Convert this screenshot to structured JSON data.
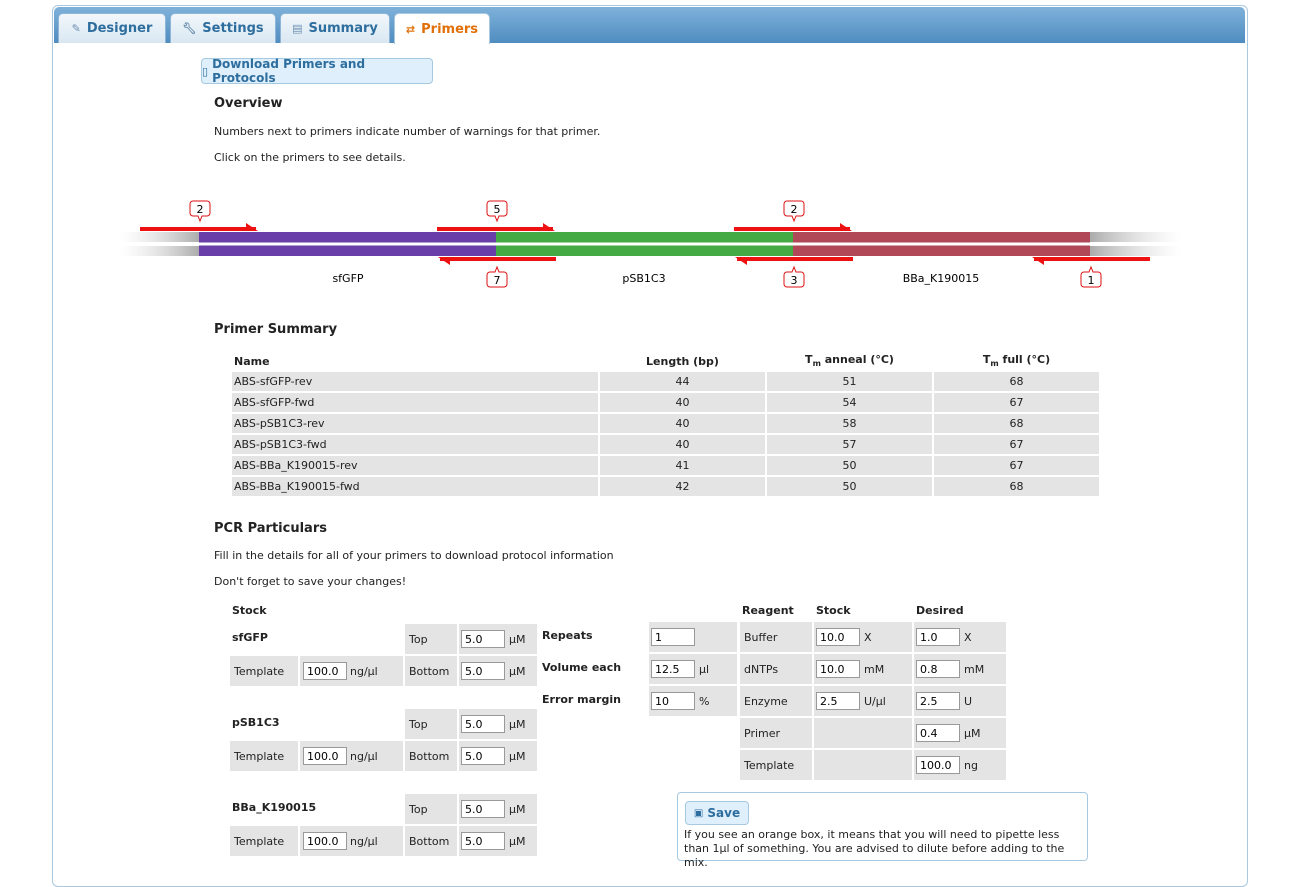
{
  "tabs": [
    {
      "label": "Designer",
      "icon": "pencil-icon"
    },
    {
      "label": "Settings",
      "icon": "wrench-icon"
    },
    {
      "label": "Summary",
      "icon": "document-icon"
    },
    {
      "label": "Primers",
      "icon": "swap-arrows-icon",
      "active": true
    }
  ],
  "download_button": "Download Primers and Protocols",
  "overview": {
    "heading": "Overview",
    "line1": "Numbers next to primers indicate number of warnings for that primer.",
    "line2": "Click on the primers to see details."
  },
  "diagram": {
    "parts": [
      {
        "name": "sfGFP",
        "color": "#6a3ea8"
      },
      {
        "name": "pSB1C3",
        "color": "#44aa44"
      },
      {
        "name": "BBa_K190015",
        "color": "#b04858"
      }
    ],
    "warnings_top": [
      "2",
      "5",
      "2"
    ],
    "warnings_bottom": [
      "7",
      "3",
      "1"
    ],
    "primer_color": "#ee1111"
  },
  "primer_summary": {
    "heading": "Primer Summary",
    "col_name": "Name",
    "col_length": "Length (bp)",
    "col_tm_anneal": "anneal (°C)",
    "col_tm_full": "full (°C)",
    "tm_T": "T",
    "tm_sub": "m",
    "rows": [
      {
        "name": "ABS-sfGFP-rev",
        "length": "44",
        "anneal": "51",
        "full": "68"
      },
      {
        "name": "ABS-sfGFP-fwd",
        "length": "40",
        "anneal": "54",
        "full": "67"
      },
      {
        "name": "ABS-pSB1C3-rev",
        "length": "40",
        "anneal": "58",
        "full": "68"
      },
      {
        "name": "ABS-pSB1C3-fwd",
        "length": "40",
        "anneal": "57",
        "full": "67"
      },
      {
        "name": "ABS-BBa_K190015-rev",
        "length": "41",
        "anneal": "50",
        "full": "67"
      },
      {
        "name": "ABS-BBa_K190015-fwd",
        "length": "42",
        "anneal": "50",
        "full": "68"
      }
    ]
  },
  "pcr": {
    "heading": "PCR Particulars",
    "line1": "Fill in the details for all of your primers to download protocol information",
    "line2": "Don't forget to save your changes!",
    "stock_heading": "Stock",
    "stocks": [
      {
        "part": "sfGFP",
        "top_label": "Top",
        "top": "5.0",
        "bottom_label": "Bottom",
        "bottom": "5.0",
        "conc_unit": "μM",
        "template_label": "Template",
        "template": "100.0",
        "template_unit": "ng/μl"
      },
      {
        "part": "pSB1C3",
        "top_label": "Top",
        "top": "5.0",
        "bottom_label": "Bottom",
        "bottom": "5.0",
        "conc_unit": "μM",
        "template_label": "Template",
        "template": "100.0",
        "template_unit": "ng/μl"
      },
      {
        "part": "BBa_K190015",
        "top_label": "Top",
        "top": "5.0",
        "bottom_label": "Bottom",
        "bottom": "5.0",
        "conc_unit": "μM",
        "template_label": "Template",
        "template": "100.0",
        "template_unit": "ng/μl"
      }
    ],
    "params": [
      {
        "label": "Repeats",
        "value": "1",
        "unit": ""
      },
      {
        "label": "Volume each",
        "value": "12.5",
        "unit": "μl"
      },
      {
        "label": "Error margin",
        "value": "10",
        "unit": "%"
      }
    ],
    "reagent_heading": "Reagent",
    "reagent_stock_heading": "Stock",
    "reagent_desired_heading": "Desired",
    "reagents": [
      {
        "name": "Buffer",
        "stock": "10.0",
        "stock_unit": "X",
        "desired": "1.0",
        "desired_unit": "X"
      },
      {
        "name": "dNTPs",
        "stock": "10.0",
        "stock_unit": "mM",
        "desired": "0.8",
        "desired_unit": "mM"
      },
      {
        "name": "Enzyme",
        "stock": "2.5",
        "stock_unit": "U/μl",
        "desired": "2.5",
        "desired_unit": "U"
      },
      {
        "name": "Primer",
        "stock": "",
        "stock_unit": "",
        "desired": "0.4",
        "desired_unit": "μM"
      },
      {
        "name": "Template",
        "stock": "",
        "stock_unit": "",
        "desired": "100.0",
        "desired_unit": "ng"
      }
    ],
    "save_label": "Save",
    "save_note": "If you see an orange box, it means that you will need to pipette less than 1μl of something. You are advised to dilute before adding to the mix."
  }
}
